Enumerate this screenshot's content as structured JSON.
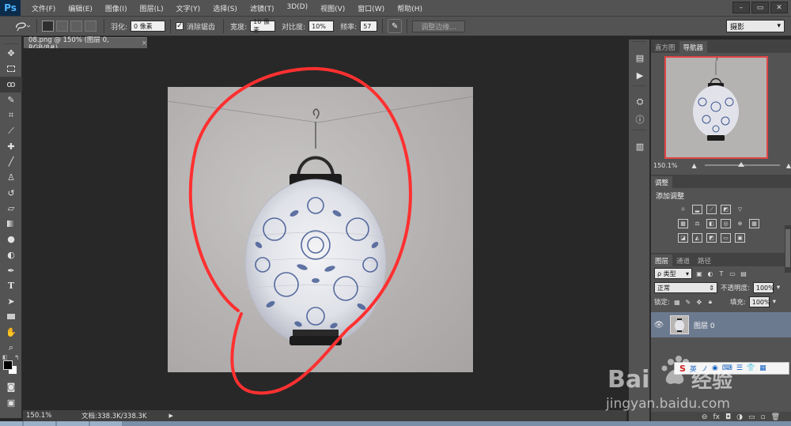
{
  "app": {
    "logo": "Ps"
  },
  "menu": [
    "文件(F)",
    "编辑(E)",
    "图像(I)",
    "图层(L)",
    "文字(Y)",
    "选择(S)",
    "滤镜(T)",
    "3D(D)",
    "视图(V)",
    "窗口(W)",
    "帮助(H)"
  ],
  "window_controls": [
    "–",
    "▭",
    "✕"
  ],
  "options": {
    "feather_label": "羽化:",
    "feather_value": "0 像素",
    "antialias_label": "消除锯齿",
    "antialias_checked": true,
    "width_label": "宽度:",
    "width_value": "10 像素",
    "contrast_label": "对比度:",
    "contrast_value": "10%",
    "frequency_label": "频率:",
    "frequency_value": "57",
    "refine_edge_label": "调整边缘...",
    "workspace": "摄影"
  },
  "document": {
    "tab_title": "08.png @ 150% (图层 0, RGB/8#)",
    "tab_close": "×",
    "zoom": "150.1%",
    "doc_size": "文档:338.3K/338.3K"
  },
  "tools": [
    "move",
    "marquee",
    "magnetic-lasso",
    "quick-select",
    "crop",
    "eyedropper",
    "spot-heal",
    "brush",
    "clone-stamp",
    "history-brush",
    "eraser",
    "gradient",
    "blur",
    "dodge",
    "pen",
    "type",
    "path-select",
    "rectangle",
    "hand",
    "zoom"
  ],
  "panels": {
    "navigator": {
      "tabs": [
        "直方图",
        "导航器"
      ],
      "active": "导航器",
      "zoom": "150.1%"
    },
    "adjustments": {
      "tab": "调整",
      "title": "添加调整"
    },
    "layers": {
      "tabs": [
        "图层",
        "通道",
        "路径"
      ],
      "active": "图层",
      "kind_label": "ρ 类型",
      "blend_mode": "正常",
      "opacity_label": "不透明度:",
      "opacity_value": "100%",
      "lock_label": "锁定:",
      "fill_label": "填充:",
      "fill_value": "100%",
      "layer_name": "图层 0"
    }
  },
  "footer_icons": [
    "link-icon",
    "fx-icon",
    "mask-icon",
    "adjustment-icon",
    "folder-icon",
    "new-layer-icon",
    "trash-icon"
  ],
  "footer_labels": [
    "⊖",
    "fx",
    "◘",
    "◑",
    "▭",
    "▫",
    "🗑"
  ],
  "watermark": {
    "brand": "Bai",
    "brand2": "经验",
    "url": "jingyan.baidu.com"
  },
  "ime": {
    "items": [
      "S",
      "英",
      "ノ",
      "◉",
      "⌨",
      "☰",
      "👕",
      "▦"
    ]
  },
  "colors": {
    "annotation": "#ff3030",
    "panel_bg": "#535353",
    "canvas_bg": "#282828",
    "selected_layer": "#6c7a90",
    "nav_border": "#e04545"
  }
}
